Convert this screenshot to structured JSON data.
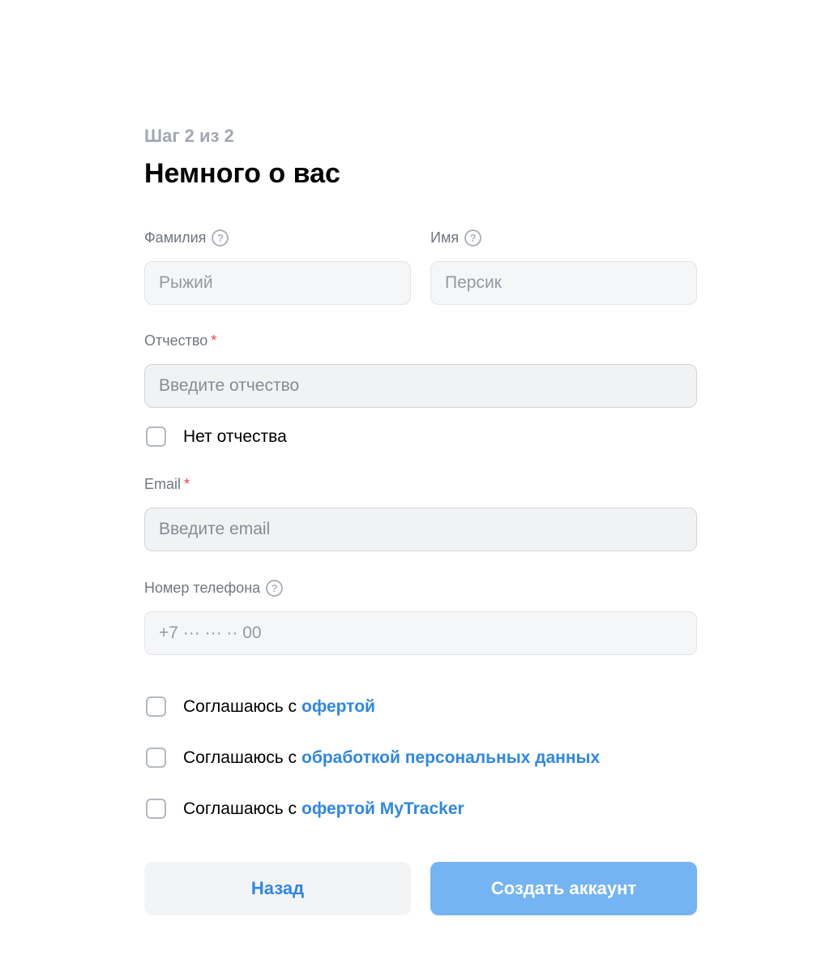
{
  "header": {
    "step": "Шаг 2 из 2",
    "title": "Немного о вас"
  },
  "fields": {
    "last_name": {
      "label": "Фамилия",
      "placeholder": "Рыжий",
      "value": ""
    },
    "first_name": {
      "label": "Имя",
      "placeholder": "Персик",
      "value": ""
    },
    "patronymic": {
      "label": "Отчество",
      "required_mark": "*",
      "placeholder": "Введите отчество",
      "value": ""
    },
    "no_patronymic": {
      "label": "Нет отчества",
      "checked": false
    },
    "email": {
      "label": "Email",
      "required_mark": "*",
      "placeholder": "Введите email",
      "value": ""
    },
    "phone": {
      "label": "Номер телефона",
      "placeholder": "+7 ··· ··· ·· 00",
      "value": ""
    }
  },
  "help_icon": "?",
  "agreements": [
    {
      "prefix": "Соглашаюсь с",
      "link": "офертой",
      "checked": false
    },
    {
      "prefix": "Соглашаюсь с",
      "link": "обработкой персональных данных",
      "checked": false
    },
    {
      "prefix": "Соглашаюсь с",
      "link": "офертой MyTracker",
      "checked": false
    }
  ],
  "buttons": {
    "back": "Назад",
    "create": "Создать аккаунт"
  },
  "colors": {
    "accent": "#2f87e6",
    "primary_disabled": "#74b4f3",
    "required": "#e64646",
    "muted": "#a2a8b1"
  },
  "icons": {
    "help": "question-circle-icon"
  }
}
